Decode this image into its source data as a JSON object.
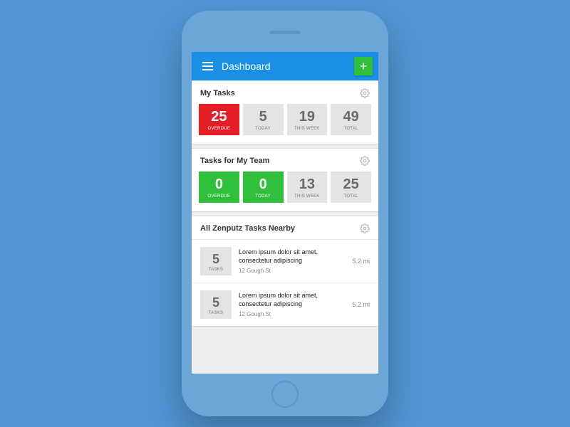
{
  "header": {
    "title": "Dashboard",
    "add_icon": "+"
  },
  "sections": {
    "my_tasks": {
      "title": "My Tasks",
      "stats": [
        {
          "value": "25",
          "label": "OVERDUE",
          "variant": "red"
        },
        {
          "value": "5",
          "label": "TODAY",
          "variant": ""
        },
        {
          "value": "19",
          "label": "THIS WEEK",
          "variant": ""
        },
        {
          "value": "49",
          "label": "TOTAL",
          "variant": ""
        }
      ]
    },
    "team_tasks": {
      "title": "Tasks for My Team",
      "stats": [
        {
          "value": "0",
          "label": "OVERDUE",
          "variant": "green"
        },
        {
          "value": "0",
          "label": "TODAY",
          "variant": "green"
        },
        {
          "value": "13",
          "label": "THIS WEEK",
          "variant": ""
        },
        {
          "value": "25",
          "label": "TOTAL",
          "variant": ""
        }
      ]
    },
    "nearby": {
      "title": "All Zenputz Tasks Nearby",
      "items": [
        {
          "count": "5",
          "count_label": "TASKS",
          "desc": "Lorem ipsum dolor sit amet, consectetur adipiscing",
          "address": "12 Gough St",
          "distance": "5.2 mi"
        },
        {
          "count": "5",
          "count_label": "TASKS",
          "desc": "Lorem ipsum dolor sit amet, consectetur adipiscing",
          "address": "12 Gough St",
          "distance": "5.2 mi"
        }
      ]
    }
  }
}
